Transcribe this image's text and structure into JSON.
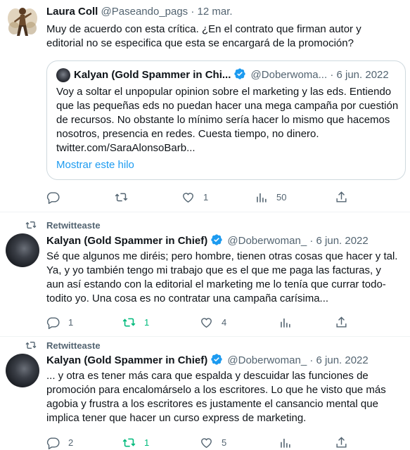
{
  "tweets": [
    {
      "name": "Laura Coll",
      "handle": "@Paseando_pags",
      "date": "· 12 mar.",
      "text": "Muy de acuerdo con esta crítica. ¿En el contrato que firman autor y editorial no se especifica que esta se encargará de la promoción?",
      "quote": {
        "name": "Kalyan (Gold Spammer in Chi...",
        "handle": "@Doberwoma...",
        "date": "· 6 jun. 2022",
        "text": "Voy a soltar el unpopular opinion sobre el marketing y las eds. Entiendo que las pequeñas eds no puedan hacer una mega campaña por cuestión de recursos. No obstante lo mínimo sería hacer lo mismo que hacemos nosotros, presencia en redes. Cuesta tiempo, no dinero. twitter.com/SaraAlonsoBarb...",
        "show_thread": "Mostrar este hilo"
      },
      "actions": {
        "reply": "",
        "retweet": "",
        "like": "1",
        "views": "50"
      }
    },
    {
      "retweet_label": "Retwitteaste",
      "name": "Kalyan (Gold Spammer in Chief)",
      "handle": "@Doberwoman_",
      "date": "· 6 jun. 2022",
      "text": "Sé que algunos me diréis; pero hombre, tienen otras cosas que hacer y tal. Ya, y yo también tengo mi trabajo que es el que me paga las facturas, y aun así estando con la editorial el marketing me lo tenía que currar todo-todito yo. Una cosa es no contratar una campaña carísima...",
      "actions": {
        "reply": "1",
        "retweet": "1",
        "like": "4",
        "views": ""
      }
    },
    {
      "retweet_label": "Retwitteaste",
      "name": "Kalyan (Gold Spammer in Chief)",
      "handle": "@Doberwoman_",
      "date": "· 6 jun. 2022",
      "text": "... y otra es tener más cara que espalda y descuidar las funciones de promoción para encalomárselo a los escritores. Lo que he visto que más agobia y frustra a los escritores es justamente el cansancio mental que implica tener que hacer un curso express de marketing.",
      "actions": {
        "reply": "2",
        "retweet": "1",
        "like": "5",
        "views": ""
      }
    }
  ],
  "colors": {
    "accent": "#1d9bf0",
    "retweet_active": "#00ba7c",
    "secondary": "#536471"
  }
}
